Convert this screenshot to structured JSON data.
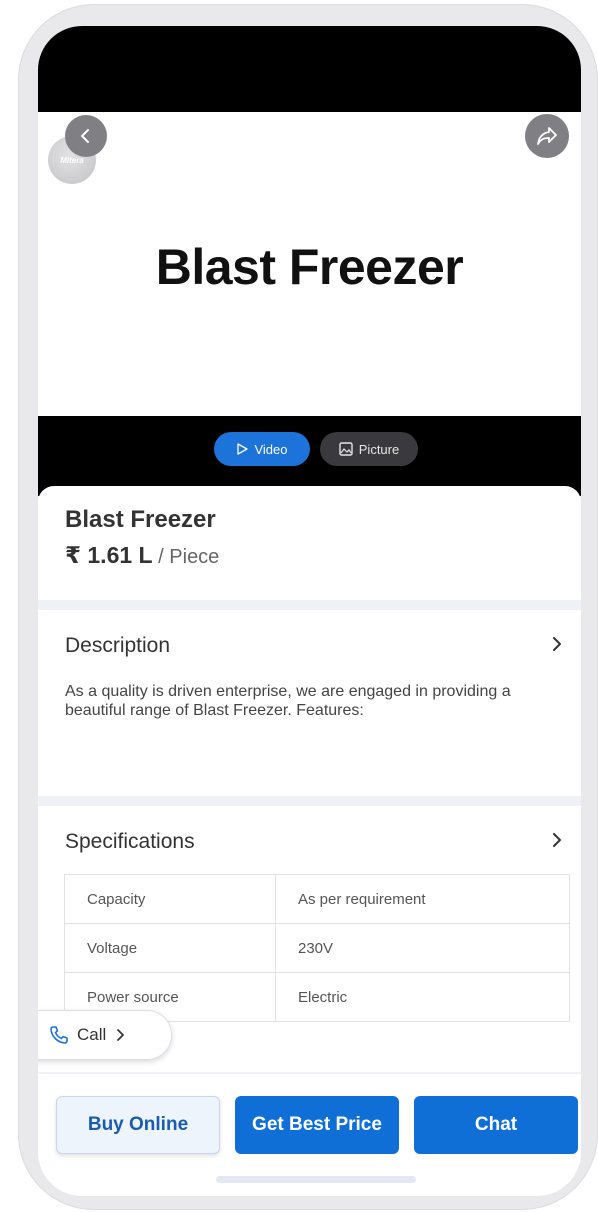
{
  "product": {
    "hero_title": "Blast Freezer",
    "logo_text": "Mitera",
    "name": "Blast Freezer",
    "price": "₹ 1.61 L",
    "price_unit": " / Piece"
  },
  "media_tabs": {
    "video_label": "Video",
    "picture_label": "Picture"
  },
  "description": {
    "title": "Description",
    "text": "As a quality is driven enterprise, we are engaged in providing a beautiful range of Blast Freezer. Features:"
  },
  "specifications": {
    "title": "Specifications",
    "rows": [
      {
        "label": "Capacity",
        "value": "As per requirement"
      },
      {
        "label": "Voltage",
        "value": "230V"
      },
      {
        "label": "Power source",
        "value": "Electric"
      }
    ]
  },
  "call": {
    "label": "Call"
  },
  "actions": {
    "buy_online": "Buy Online",
    "get_best_price": "Get Best Price",
    "chat": "Chat"
  },
  "icons": {
    "back": "chevron-left-icon",
    "share": "share-arrow-icon",
    "video": "play-outline-icon",
    "picture": "image-icon",
    "phone": "phone-icon",
    "chevron": "chevron-right-icon"
  },
  "colors": {
    "primary": "#0f6fd6",
    "video_tab": "#1c73d9",
    "status_bar": "#000000"
  }
}
